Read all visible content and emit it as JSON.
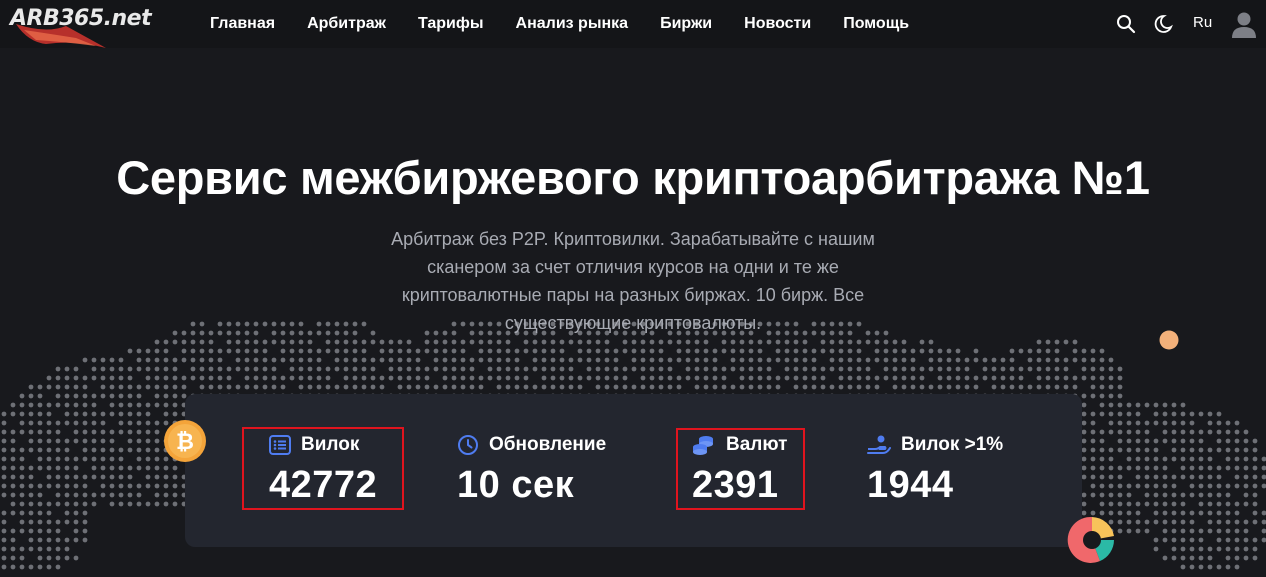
{
  "header": {
    "logo": "ARB365.net",
    "nav": [
      "Главная",
      "Арбитраж",
      "Тарифы",
      "Анализ рынка",
      "Биржи",
      "Новости",
      "Помощь"
    ],
    "icons": [
      "search-icon",
      "moon-icon",
      "avatar-icon"
    ],
    "language": "Ru"
  },
  "hero": {
    "title": "Сервис межбиржевого криптоарбитража №1",
    "subtitle": "Арбитраж без P2P. Криптовилки. Зарабатывайте с нашим сканером за счет отличия курсов на одни и те же криптовалютные пары на разных биржах. 10 бирж. Все существующие криптовалюты."
  },
  "stats": [
    {
      "label": "Вилок",
      "value": "42772",
      "icon": "list-icon"
    },
    {
      "label": "Обновление",
      "value": "10 сек",
      "icon": "clock-icon"
    },
    {
      "label": "Валют",
      "value": "2391",
      "icon": "coins-icon"
    },
    {
      "label": "Вилок >1%",
      "value": "1944",
      "icon": "hand-coin-icon"
    }
  ],
  "colors": {
    "background": "#18191d",
    "header": "#141518",
    "card": "#23262f",
    "accent_blue": "#4f7cf0",
    "highlight": "#e0141e",
    "bitcoin": "#f4a43a"
  }
}
